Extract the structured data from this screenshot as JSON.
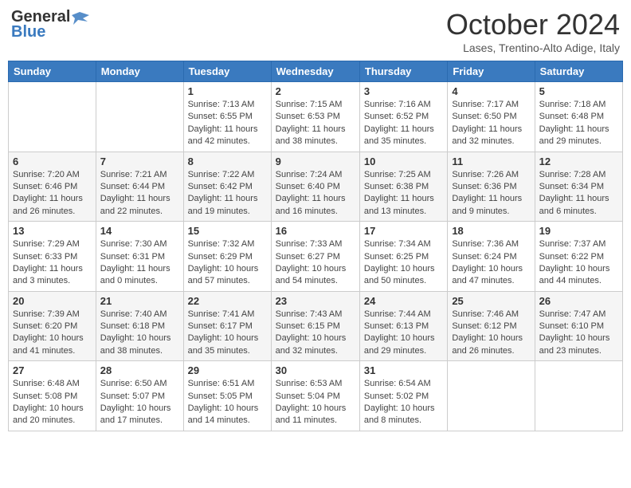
{
  "header": {
    "logo_general": "General",
    "logo_blue": "Blue",
    "month": "October 2024",
    "location": "Lases, Trentino-Alto Adige, Italy"
  },
  "weekdays": [
    "Sunday",
    "Monday",
    "Tuesday",
    "Wednesday",
    "Thursday",
    "Friday",
    "Saturday"
  ],
  "weeks": [
    [
      {
        "day": "",
        "sunrise": "",
        "sunset": "",
        "daylight": ""
      },
      {
        "day": "",
        "sunrise": "",
        "sunset": "",
        "daylight": ""
      },
      {
        "day": "1",
        "sunrise": "Sunrise: 7:13 AM",
        "sunset": "Sunset: 6:55 PM",
        "daylight": "Daylight: 11 hours and 42 minutes."
      },
      {
        "day": "2",
        "sunrise": "Sunrise: 7:15 AM",
        "sunset": "Sunset: 6:53 PM",
        "daylight": "Daylight: 11 hours and 38 minutes."
      },
      {
        "day": "3",
        "sunrise": "Sunrise: 7:16 AM",
        "sunset": "Sunset: 6:52 PM",
        "daylight": "Daylight: 11 hours and 35 minutes."
      },
      {
        "day": "4",
        "sunrise": "Sunrise: 7:17 AM",
        "sunset": "Sunset: 6:50 PM",
        "daylight": "Daylight: 11 hours and 32 minutes."
      },
      {
        "day": "5",
        "sunrise": "Sunrise: 7:18 AM",
        "sunset": "Sunset: 6:48 PM",
        "daylight": "Daylight: 11 hours and 29 minutes."
      }
    ],
    [
      {
        "day": "6",
        "sunrise": "Sunrise: 7:20 AM",
        "sunset": "Sunset: 6:46 PM",
        "daylight": "Daylight: 11 hours and 26 minutes."
      },
      {
        "day": "7",
        "sunrise": "Sunrise: 7:21 AM",
        "sunset": "Sunset: 6:44 PM",
        "daylight": "Daylight: 11 hours and 22 minutes."
      },
      {
        "day": "8",
        "sunrise": "Sunrise: 7:22 AM",
        "sunset": "Sunset: 6:42 PM",
        "daylight": "Daylight: 11 hours and 19 minutes."
      },
      {
        "day": "9",
        "sunrise": "Sunrise: 7:24 AM",
        "sunset": "Sunset: 6:40 PM",
        "daylight": "Daylight: 11 hours and 16 minutes."
      },
      {
        "day": "10",
        "sunrise": "Sunrise: 7:25 AM",
        "sunset": "Sunset: 6:38 PM",
        "daylight": "Daylight: 11 hours and 13 minutes."
      },
      {
        "day": "11",
        "sunrise": "Sunrise: 7:26 AM",
        "sunset": "Sunset: 6:36 PM",
        "daylight": "Daylight: 11 hours and 9 minutes."
      },
      {
        "day": "12",
        "sunrise": "Sunrise: 7:28 AM",
        "sunset": "Sunset: 6:34 PM",
        "daylight": "Daylight: 11 hours and 6 minutes."
      }
    ],
    [
      {
        "day": "13",
        "sunrise": "Sunrise: 7:29 AM",
        "sunset": "Sunset: 6:33 PM",
        "daylight": "Daylight: 11 hours and 3 minutes."
      },
      {
        "day": "14",
        "sunrise": "Sunrise: 7:30 AM",
        "sunset": "Sunset: 6:31 PM",
        "daylight": "Daylight: 11 hours and 0 minutes."
      },
      {
        "day": "15",
        "sunrise": "Sunrise: 7:32 AM",
        "sunset": "Sunset: 6:29 PM",
        "daylight": "Daylight: 10 hours and 57 minutes."
      },
      {
        "day": "16",
        "sunrise": "Sunrise: 7:33 AM",
        "sunset": "Sunset: 6:27 PM",
        "daylight": "Daylight: 10 hours and 54 minutes."
      },
      {
        "day": "17",
        "sunrise": "Sunrise: 7:34 AM",
        "sunset": "Sunset: 6:25 PM",
        "daylight": "Daylight: 10 hours and 50 minutes."
      },
      {
        "day": "18",
        "sunrise": "Sunrise: 7:36 AM",
        "sunset": "Sunset: 6:24 PM",
        "daylight": "Daylight: 10 hours and 47 minutes."
      },
      {
        "day": "19",
        "sunrise": "Sunrise: 7:37 AM",
        "sunset": "Sunset: 6:22 PM",
        "daylight": "Daylight: 10 hours and 44 minutes."
      }
    ],
    [
      {
        "day": "20",
        "sunrise": "Sunrise: 7:39 AM",
        "sunset": "Sunset: 6:20 PM",
        "daylight": "Daylight: 10 hours and 41 minutes."
      },
      {
        "day": "21",
        "sunrise": "Sunrise: 7:40 AM",
        "sunset": "Sunset: 6:18 PM",
        "daylight": "Daylight: 10 hours and 38 minutes."
      },
      {
        "day": "22",
        "sunrise": "Sunrise: 7:41 AM",
        "sunset": "Sunset: 6:17 PM",
        "daylight": "Daylight: 10 hours and 35 minutes."
      },
      {
        "day": "23",
        "sunrise": "Sunrise: 7:43 AM",
        "sunset": "Sunset: 6:15 PM",
        "daylight": "Daylight: 10 hours and 32 minutes."
      },
      {
        "day": "24",
        "sunrise": "Sunrise: 7:44 AM",
        "sunset": "Sunset: 6:13 PM",
        "daylight": "Daylight: 10 hours and 29 minutes."
      },
      {
        "day": "25",
        "sunrise": "Sunrise: 7:46 AM",
        "sunset": "Sunset: 6:12 PM",
        "daylight": "Daylight: 10 hours and 26 minutes."
      },
      {
        "day": "26",
        "sunrise": "Sunrise: 7:47 AM",
        "sunset": "Sunset: 6:10 PM",
        "daylight": "Daylight: 10 hours and 23 minutes."
      }
    ],
    [
      {
        "day": "27",
        "sunrise": "Sunrise: 6:48 AM",
        "sunset": "Sunset: 5:08 PM",
        "daylight": "Daylight: 10 hours and 20 minutes."
      },
      {
        "day": "28",
        "sunrise": "Sunrise: 6:50 AM",
        "sunset": "Sunset: 5:07 PM",
        "daylight": "Daylight: 10 hours and 17 minutes."
      },
      {
        "day": "29",
        "sunrise": "Sunrise: 6:51 AM",
        "sunset": "Sunset: 5:05 PM",
        "daylight": "Daylight: 10 hours and 14 minutes."
      },
      {
        "day": "30",
        "sunrise": "Sunrise: 6:53 AM",
        "sunset": "Sunset: 5:04 PM",
        "daylight": "Daylight: 10 hours and 11 minutes."
      },
      {
        "day": "31",
        "sunrise": "Sunrise: 6:54 AM",
        "sunset": "Sunset: 5:02 PM",
        "daylight": "Daylight: 10 hours and 8 minutes."
      },
      {
        "day": "",
        "sunrise": "",
        "sunset": "",
        "daylight": ""
      },
      {
        "day": "",
        "sunrise": "",
        "sunset": "",
        "daylight": ""
      }
    ]
  ]
}
